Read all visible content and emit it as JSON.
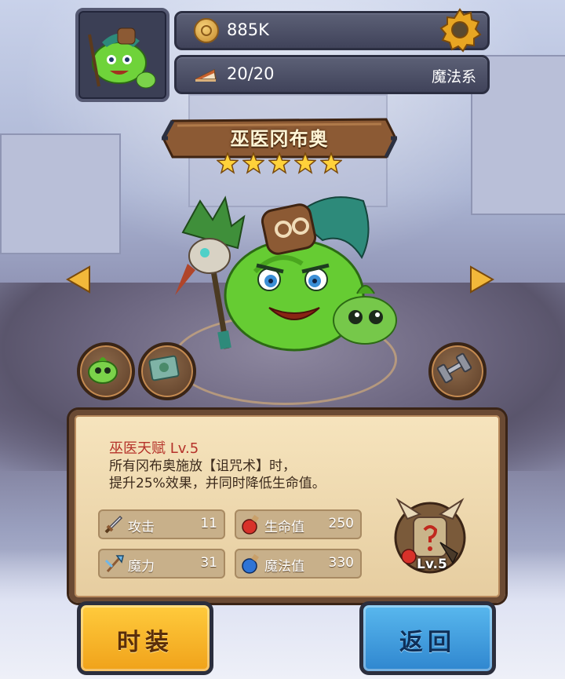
{
  "header": {
    "gold": "885K",
    "stamina": "20/20",
    "element": "魔法系"
  },
  "hero": {
    "name": "巫医冈布奥",
    "stars": 5
  },
  "talent": {
    "title": "巫医天赋 Lv.5",
    "description_line1": "所有冈布奥施放【诅咒术】时，",
    "description_line2": "提升25%效果，并同时降低生命值。"
  },
  "stats": [
    {
      "label": "攻击",
      "value": "11",
      "icon": "sword-icon"
    },
    {
      "label": "生命值",
      "value": "250",
      "icon": "red-potion-icon"
    },
    {
      "label": "魔力",
      "value": "31",
      "icon": "staff-icon"
    },
    {
      "label": "魔法值",
      "value": "330",
      "icon": "blue-potion-icon"
    }
  ],
  "badge_level": "Lv.5",
  "buttons": {
    "costume": "时装",
    "back": "返回"
  },
  "colors": {
    "talent_title": "#b5322a",
    "costume_button": "#f0a21a",
    "back_button": "#2f86cf"
  }
}
